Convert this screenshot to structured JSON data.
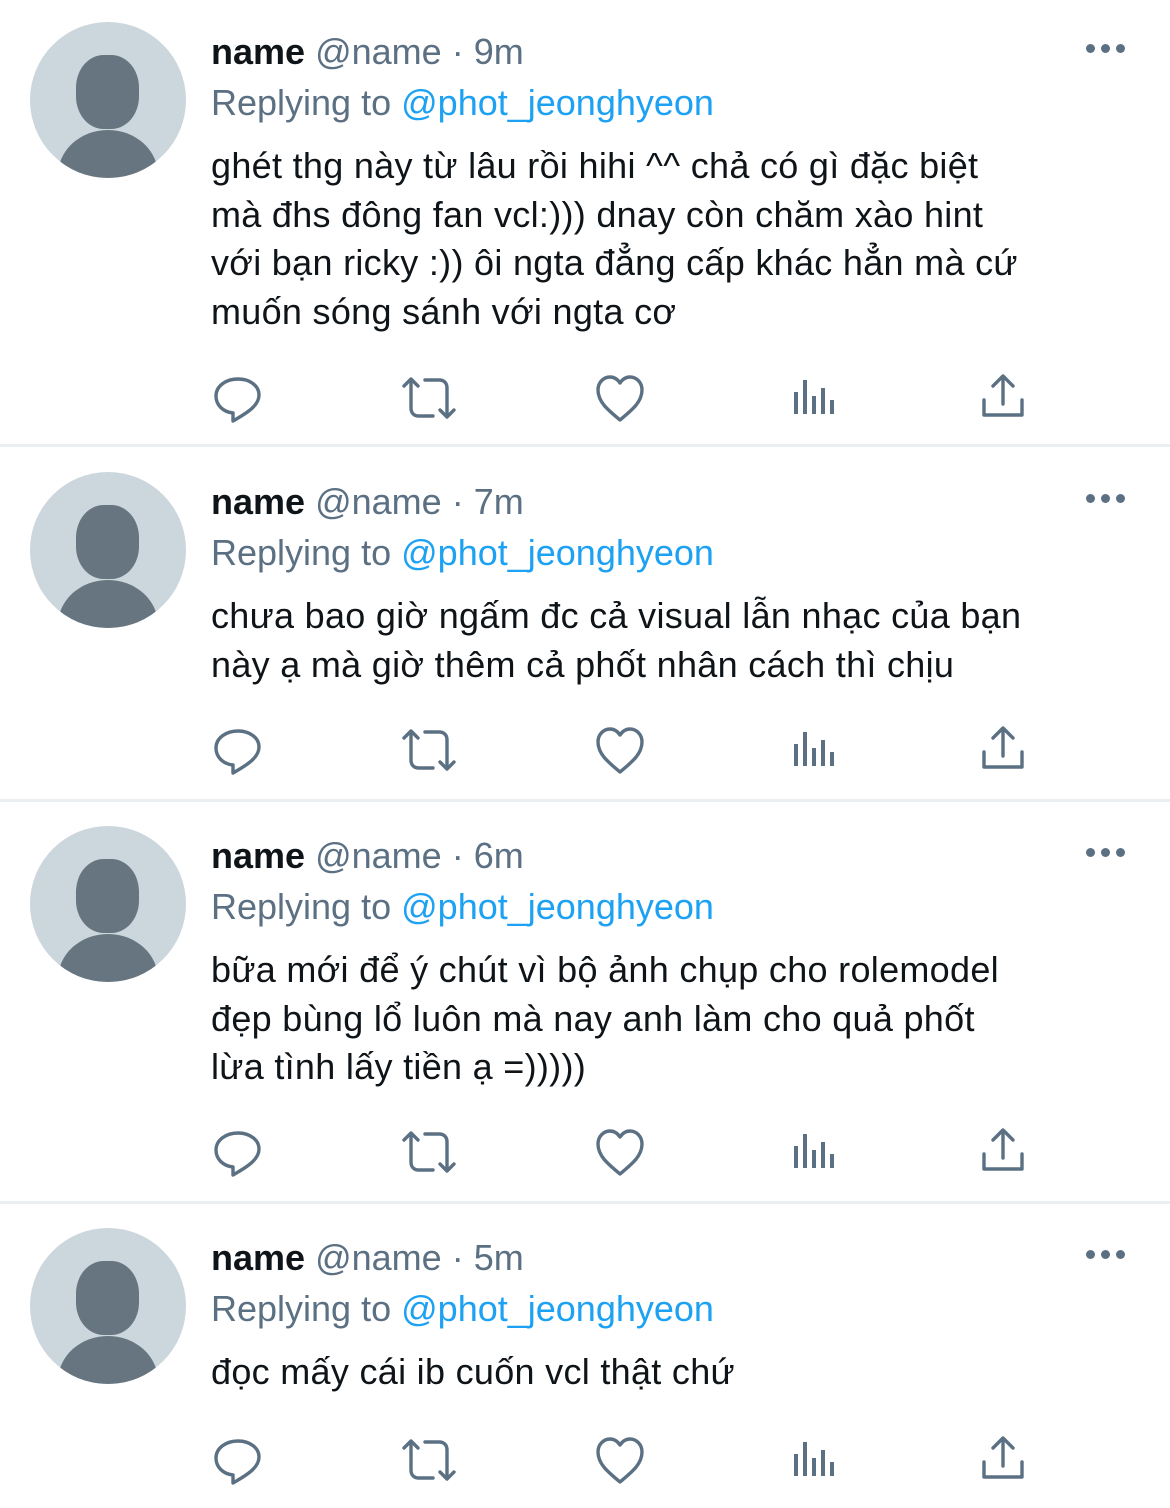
{
  "tweets": [
    {
      "name": "name",
      "handle": "@name",
      "sep": "·",
      "time": "9m",
      "reply_prefix": "Replying to",
      "reply_to": "@phot_jeonghyeon",
      "text": "ghét thg này từ lâu rồi hihi ^^ chả có gì đặc biệt\nmà đhs đông fan vcl:))) dnay còn chăm xào hint\nvới bạn ricky :)) ôi ngta đẳng cấp khác hẳn mà cứ\nmuốn sóng sánh với ngta cơ"
    },
    {
      "name": "name",
      "handle": "@name",
      "sep": "·",
      "time": "7m",
      "reply_prefix": "Replying to",
      "reply_to": "@phot_jeonghyeon",
      "text": "chưa bao giờ ngấm đc cả visual lẫn nhạc của bạn\nnày ạ mà giờ thêm cả phốt nhân cách thì chịu"
    },
    {
      "name": "name",
      "handle": "@name",
      "sep": "·",
      "time": "6m",
      "reply_prefix": "Replying to",
      "reply_to": "@phot_jeonghyeon",
      "text": "bữa mới để ý chút vì bộ ảnh chụp cho rolemodel\nđẹp bùng lổ luôn mà nay anh làm cho quả phốt\nlừa tình lấy tiền ạ =)))))"
    },
    {
      "name": "name",
      "handle": "@name",
      "sep": "·",
      "time": "5m",
      "reply_prefix": "Replying to",
      "reply_to": "@phot_jeonghyeon",
      "text": "đọc mấy cái ib cuốn vcl thật chứ"
    }
  ],
  "colors": {
    "text": "#0f1419",
    "secondary": "#5b7083",
    "link": "#1da1f2",
    "avatar_bg": "#ccd6dd",
    "avatar_fg": "#66757f",
    "divider": "#eceff1"
  },
  "icons": [
    "reply-icon",
    "retweet-icon",
    "like-icon",
    "analytics-icon",
    "share-icon",
    "more-icon"
  ]
}
